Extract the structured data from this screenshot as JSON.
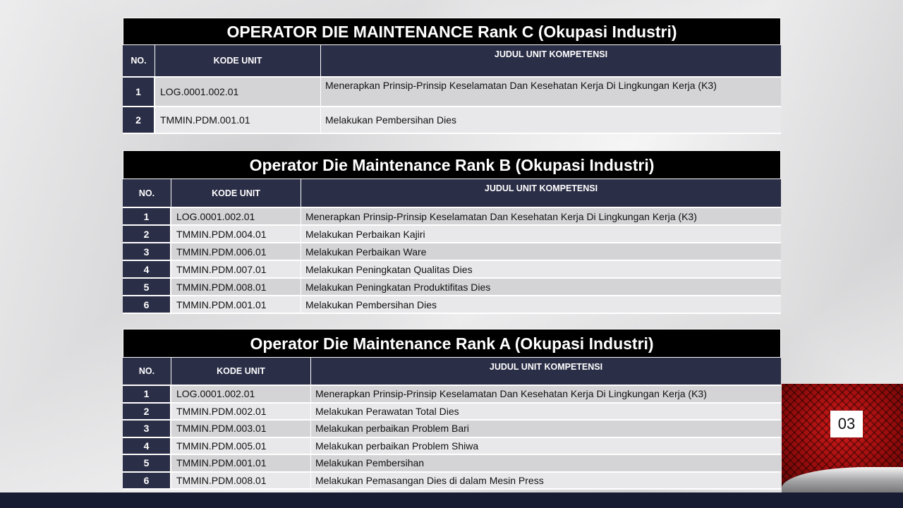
{
  "page_number": "03",
  "header_labels": {
    "no": "NO.",
    "code": "KODE  UNIT",
    "title": "JUDUL  UNIT  KOMPETENSI"
  },
  "tables": [
    {
      "title": "OPERATOR DIE MAINTENANCE Rank C (Okupasi Industri)",
      "rows": [
        {
          "no": "1",
          "code": "LOG.0001.002.01",
          "title": "Menerapkan  Prinsip-Prinsip  Keselamatan  Dan  Kesehatan  Kerja  Di   Lingkungan  Kerja   (K3)"
        },
        {
          "no": "2",
          "code": "TMMIN.PDM.001.01",
          "title": "Melakukan  Pembersihan Dies"
        }
      ]
    },
    {
      "title": "Operator Die Maintenance Rank B (Okupasi Industri)",
      "rows": [
        {
          "no": "1",
          "code": "LOG.0001.002.01",
          "title": "Menerapkan  Prinsip-Prinsip  Keselamatan  Dan  Kesehatan  Kerja  Di   Lingkungan  Kerja   (K3)"
        },
        {
          "no": "2",
          "code": "TMMIN.PDM.004.01",
          "title": "Melakukan  Perbaikan  Kajiri"
        },
        {
          "no": "3",
          "code": "TMMIN.PDM.006.01",
          "title": "Melakukan  Perbaikan  Ware"
        },
        {
          "no": "4",
          "code": "TMMIN.PDM.007.01",
          "title": "Melakukan  Peningkatan  Qualitas Dies"
        },
        {
          "no": "5",
          "code": "TMMIN.PDM.008.01",
          "title": "Melakukan  Peningkatan  Produktifitas Dies"
        },
        {
          "no": "6",
          "code": "TMMIN.PDM.001.01",
          "title": "Melakukan  Pembersihan Dies"
        }
      ]
    },
    {
      "title": "Operator Die Maintenance Rank A (Okupasi Industri)",
      "rows": [
        {
          "no": "1",
          "code": "LOG.0001.002.01",
          "title": "Menerapkan  Prinsip-Prinsip  Keselamatan  Dan  Kesehatan  Kerja  Di   Lingkungan  Kerja   (K3)"
        },
        {
          "no": "2",
          "code": "TMMIN.PDM.002.01",
          "title": "Melakukan  Perawatan  Total  Dies"
        },
        {
          "no": "3",
          "code": "TMMIN.PDM.003.01",
          "title": "Melakukan  perbaikan  Problem  Bari"
        },
        {
          "no": "4",
          "code": "TMMIN.PDM.005.01",
          "title": "Melakukan  perbaikan  Problem  Shiwa"
        },
        {
          "no": "5",
          "code": "TMMIN.PDM.001.01",
          "title": "Melakukan  Pembersihan"
        },
        {
          "no": "6",
          "code": "TMMIN.PDM.008.01",
          "title": "Melakukan  Pemasangan  Dies  di  dalam  Mesin  Press"
        }
      ]
    }
  ]
}
